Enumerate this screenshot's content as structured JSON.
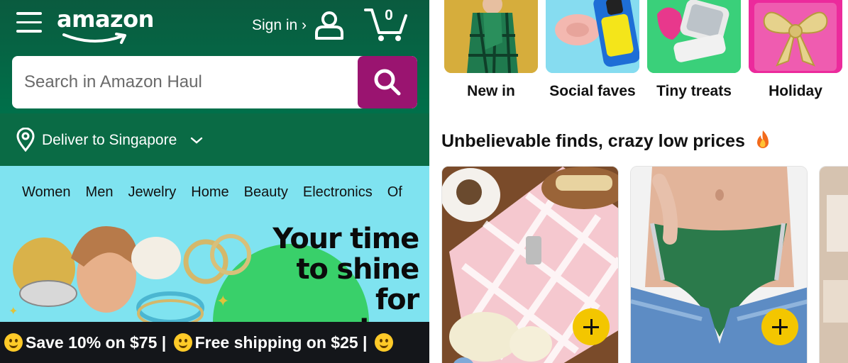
{
  "header": {
    "logo_text": "amazon",
    "signin_label": "Sign in ›",
    "cart_count": "0",
    "search_placeholder": "Search in Amazon Haul"
  },
  "delivery": {
    "label": "Deliver to Singapore"
  },
  "nav_links": [
    "Women",
    "Men",
    "Jewelry",
    "Home",
    "Beauty",
    "Electronics",
    "Of"
  ],
  "banner": {
    "headline_line1": "Your time",
    "headline_line2": "to shine for",
    "headline_line3": "way less"
  },
  "promo_strip": {
    "text1": "Save 10% on $75 |",
    "text2": "Free shipping on $25 |"
  },
  "categories": [
    {
      "label": "New in",
      "icon": "scarf-model-image"
    },
    {
      "label": "Social faves",
      "icon": "phone-case-image"
    },
    {
      "label": "Tiny treats",
      "icon": "makeup-mirror-image"
    },
    {
      "label": "Holiday",
      "icon": "gold-bow-image"
    }
  ],
  "section": {
    "title": "Unbelievable finds, crazy low prices",
    "icon": "fire-icon"
  },
  "colors": {
    "header_green": "#00623e",
    "search_button": "#9a1470",
    "promo_bg": "#7fe3f0",
    "add_button": "#f3c600"
  }
}
